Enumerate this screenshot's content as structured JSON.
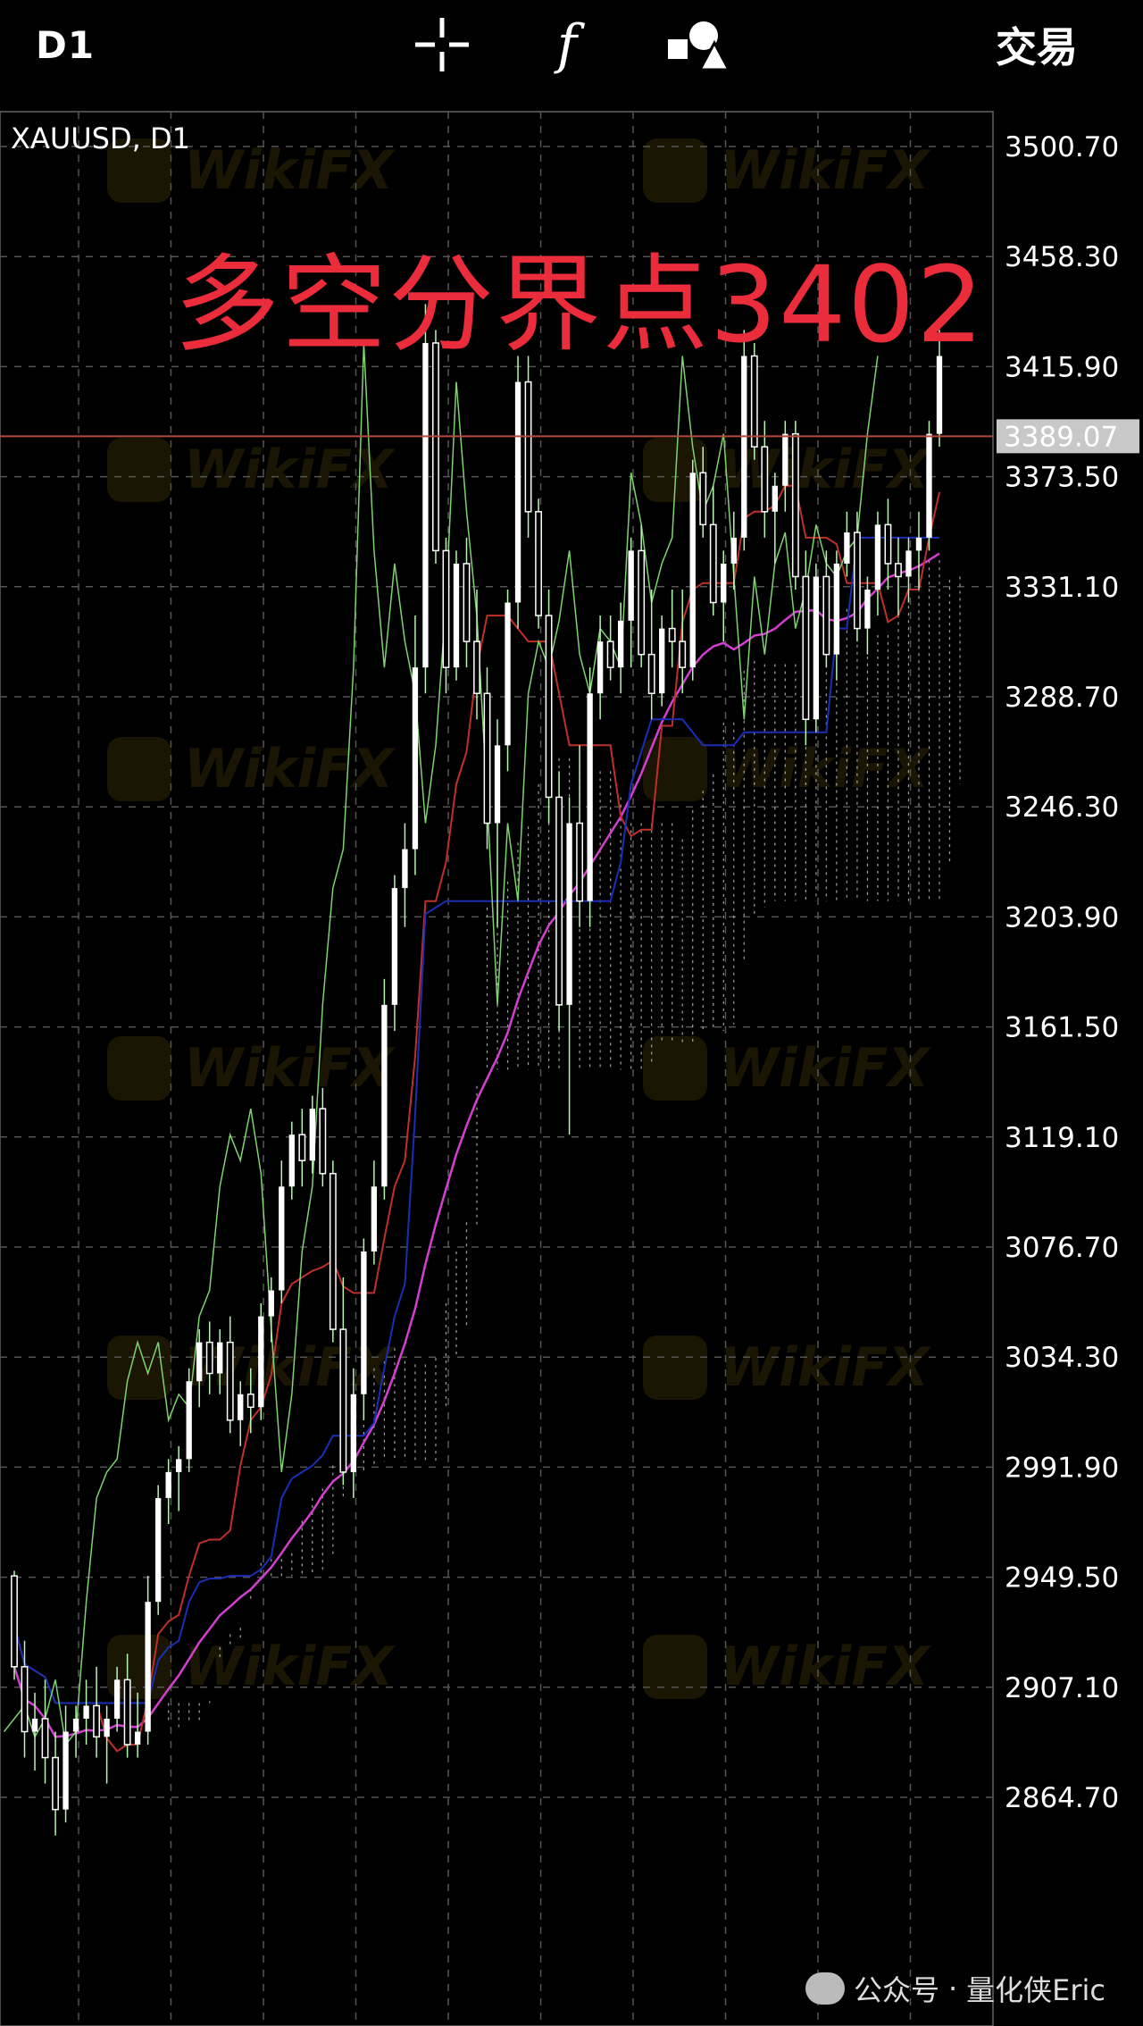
{
  "toolbar": {
    "timeframe": "D1",
    "crosshair_icon": "crosshair-icon",
    "function_icon": "f",
    "objects_icon": "shapes-icon",
    "trade_label": "交易"
  },
  "chart": {
    "symbol_label": "XAUUSD, D1",
    "headline": "多空分界点3402",
    "current_price": "3389.07",
    "footer": {
      "prefix": "公众号",
      "sep": "·",
      "name": "量化侠Eric"
    },
    "watermark_text": "WikiFX"
  },
  "colors": {
    "background": "#000000",
    "bull_candle": "#ffffff",
    "candle_wick": "#b9f5b3",
    "tenkan": "#c0302a",
    "kijun": "#1a2fb5",
    "chikou": "#7ed36f",
    "senkou": "#d8d8d8",
    "ma": "#d43fd1",
    "headline": "#ea2c3b",
    "price_line": "#b44a3f"
  },
  "chart_data": {
    "type": "candlestick",
    "symbol": "XAUUSD",
    "timeframe": "D1",
    "ylim": [
      2843.5,
      3521.9
    ],
    "y_ticks": [
      3500.7,
      3458.3,
      3415.9,
      3373.5,
      3331.1,
      3288.7,
      3246.3,
      3203.9,
      3161.5,
      3119.1,
      3076.7,
      3034.3,
      2991.9,
      2949.5,
      2907.1,
      2864.7
    ],
    "y_tick_labels": [
      "3500.70",
      "3458.30",
      "3415.90",
      "3373.50",
      "3331.10",
      "3288.70",
      "3246.30",
      "3203.90",
      "3161.50",
      "3119.10",
      "3076.70",
      "3034.30",
      "2991.90",
      "2949.50",
      "2907.10",
      "2864.70"
    ],
    "current_price": 3389.07,
    "indicators": [
      "Ichimoku Kinko Hyo",
      "Moving Average"
    ],
    "candles": [
      [
        2950,
        2952,
        2910,
        2915
      ],
      [
        2915,
        2925,
        2880,
        2890
      ],
      [
        2890,
        2905,
        2875,
        2895
      ],
      [
        2895,
        2910,
        2870,
        2880
      ],
      [
        2880,
        2890,
        2850,
        2860
      ],
      [
        2860,
        2900,
        2855,
        2890
      ],
      [
        2890,
        2900,
        2880,
        2895
      ],
      [
        2895,
        2910,
        2885,
        2900
      ],
      [
        2900,
        2915,
        2880,
        2888
      ],
      [
        2888,
        2900,
        2870,
        2895
      ],
      [
        2895,
        2915,
        2890,
        2910
      ],
      [
        2910,
        2920,
        2880,
        2885
      ],
      [
        2885,
        2905,
        2880,
        2890
      ],
      [
        2890,
        2950,
        2885,
        2940
      ],
      [
        2940,
        2985,
        2935,
        2980
      ],
      [
        2980,
        2995,
        2970,
        2990
      ],
      [
        2990,
        3000,
        2975,
        2995
      ],
      [
        2995,
        3030,
        2990,
        3025
      ],
      [
        3025,
        3045,
        3015,
        3040
      ],
      [
        3040,
        3048,
        3020,
        3028
      ],
      [
        3028,
        3045,
        3020,
        3040
      ],
      [
        3040,
        3050,
        3005,
        3010
      ],
      [
        3010,
        3025,
        3000,
        3020
      ],
      [
        3020,
        3030,
        3005,
        3015
      ],
      [
        3015,
        3055,
        3010,
        3050
      ],
      [
        3050,
        3065,
        3040,
        3060
      ],
      [
        3060,
        3110,
        3055,
        3100
      ],
      [
        3100,
        3125,
        3095,
        3120
      ],
      [
        3120,
        3130,
        3100,
        3110
      ],
      [
        3110,
        3135,
        3105,
        3130
      ],
      [
        3130,
        3138,
        3100,
        3105
      ],
      [
        3105,
        3110,
        3040,
        3045
      ],
      [
        3045,
        3065,
        2985,
        2990
      ],
      [
        2990,
        3030,
        2980,
        3020
      ],
      [
        3020,
        3080,
        3010,
        3075
      ],
      [
        3075,
        3110,
        3070,
        3100
      ],
      [
        3100,
        3180,
        3095,
        3170
      ],
      [
        3170,
        3220,
        3160,
        3215
      ],
      [
        3215,
        3240,
        3200,
        3230
      ],
      [
        3230,
        3320,
        3220,
        3300
      ],
      [
        3300,
        3440,
        3290,
        3425
      ],
      [
        3425,
        3430,
        3340,
        3345
      ],
      [
        3345,
        3350,
        3290,
        3300
      ],
      [
        3300,
        3345,
        3295,
        3340
      ],
      [
        3340,
        3350,
        3300,
        3310
      ],
      [
        3310,
        3330,
        3280,
        3290
      ],
      [
        3290,
        3300,
        3230,
        3240
      ],
      [
        3240,
        3280,
        3200,
        3270
      ],
      [
        3270,
        3330,
        3260,
        3325
      ],
      [
        3325,
        3420,
        3315,
        3410
      ],
      [
        3410,
        3420,
        3350,
        3360
      ],
      [
        3360,
        3365,
        3315,
        3320
      ],
      [
        3320,
        3330,
        3240,
        3250
      ],
      [
        3250,
        3260,
        3160,
        3170
      ],
      [
        3170,
        3250,
        3120,
        3240
      ],
      [
        3240,
        3270,
        3200,
        3210
      ],
      [
        3210,
        3300,
        3200,
        3290
      ],
      [
        3290,
        3320,
        3280,
        3310
      ],
      [
        3310,
        3320,
        3295,
        3300
      ],
      [
        3300,
        3325,
        3290,
        3318
      ],
      [
        3318,
        3350,
        3300,
        3345
      ],
      [
        3345,
        3355,
        3300,
        3305
      ],
      [
        3305,
        3330,
        3280,
        3290
      ],
      [
        3290,
        3320,
        3285,
        3315
      ],
      [
        3315,
        3330,
        3300,
        3310
      ],
      [
        3310,
        3330,
        3290,
        3300
      ],
      [
        3300,
        3380,
        3295,
        3375
      ],
      [
        3375,
        3385,
        3350,
        3355
      ],
      [
        3355,
        3370,
        3320,
        3325
      ],
      [
        3325,
        3345,
        3310,
        3340
      ],
      [
        3340,
        3360,
        3330,
        3350
      ],
      [
        3350,
        3430,
        3345,
        3420
      ],
      [
        3420,
        3425,
        3380,
        3385
      ],
      [
        3385,
        3395,
        3350,
        3360
      ],
      [
        3360,
        3375,
        3340,
        3370
      ],
      [
        3370,
        3395,
        3360,
        3390
      ],
      [
        3390,
        3395,
        3330,
        3335
      ],
      [
        3335,
        3345,
        3270,
        3280
      ],
      [
        3280,
        3340,
        3275,
        3335
      ],
      [
        3335,
        3345,
        3300,
        3305
      ],
      [
        3305,
        3345,
        3295,
        3340
      ],
      [
        3340,
        3360,
        3335,
        3352
      ],
      [
        3352,
        3360,
        3310,
        3315
      ],
      [
        3315,
        3335,
        3305,
        3330
      ],
      [
        3330,
        3360,
        3320,
        3355
      ],
      [
        3355,
        3365,
        3330,
        3340
      ],
      [
        3340,
        3350,
        3320,
        3335
      ],
      [
        3335,
        3350,
        3325,
        3345
      ],
      [
        3345,
        3360,
        3330,
        3350
      ],
      [
        3350,
        3395,
        3345,
        3390
      ],
      [
        3390,
        3430,
        3385,
        3420
      ]
    ]
  }
}
